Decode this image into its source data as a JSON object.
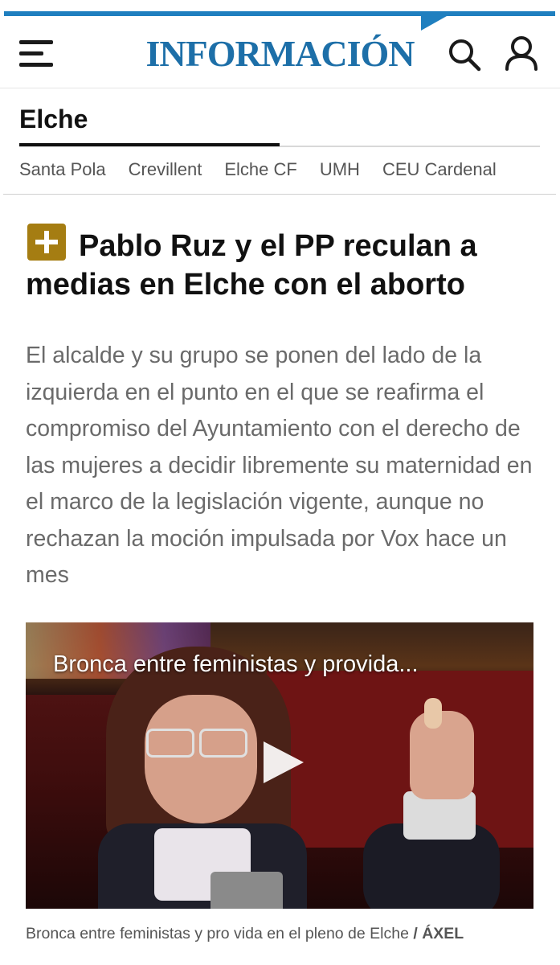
{
  "header": {
    "logo_text": "INFORMACIÓN",
    "brand_color": "#1d6fa8",
    "menu_icon": "hamburger-menu-icon",
    "search_icon": "search-icon",
    "user_icon": "user-icon"
  },
  "section": {
    "title": "Elche",
    "subnav": [
      "Santa Pola",
      "Crevillent",
      "Elche CF",
      "UMH",
      "CEU Cardenal"
    ]
  },
  "article": {
    "badge_icon": "plus-premium-icon",
    "badge_color": "#a57d12",
    "headline": "Pablo Ruz y el PP reculan a medias en Elche con el aborto",
    "lead": "El alcalde y su grupo se ponen del lado de la izquierda en el punto en el que se reafirma el compromiso del Ayuntamiento con el derecho de las mujeres a decidir libremente su maternidad en el marco de la legislación vigente, aunque no rechazan la moción impulsada por Vox hace un mes"
  },
  "video": {
    "title": "Bronca entre feministas y provida...",
    "play_icon": "play-icon",
    "caption": "Bronca entre feministas y pro vida en el pleno de Elche",
    "credit": "/ ÁXEL"
  }
}
